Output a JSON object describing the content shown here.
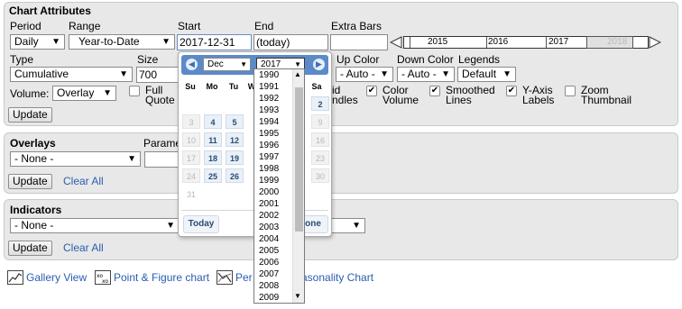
{
  "chart_attributes": {
    "title": "Chart Attributes",
    "period_label": "Period",
    "period_value": "Daily",
    "range_label": "Range",
    "range_value": "Year-to-Date",
    "start_label": "Start",
    "start_value": "2017-12-31",
    "end_label": "End",
    "end_value": "(today)",
    "extra_bars_label": "Extra Bars",
    "extra_bars_value": "",
    "timeline_years": [
      "2015",
      "2016",
      "2017",
      "2018"
    ],
    "type_label": "Type",
    "type_value": "Cumulative",
    "size_label": "Size",
    "size_value": "700",
    "up_color_label": "Up Color",
    "up_color_value": "- Auto -",
    "down_color_label": "Down Color",
    "down_color_value": "- Auto -",
    "legends_label": "Legends",
    "legends_value": "Default",
    "volume_label": "Volume:",
    "volume_value": "Overlay",
    "full_quote_label_1": "Full",
    "full_quote_label_2": "Quote",
    "solid_candles_label_1": "id",
    "solid_candles_label_2": "ndles",
    "color_volume_label_1": "Color",
    "color_volume_label_2": "Volume",
    "smoothed_lines_label_1": "Smoothed",
    "smoothed_lines_label_2": "Lines",
    "y_axis_labels_label_1": "Y-Axis",
    "y_axis_labels_label_2": "Labels",
    "zoom_thumbnail_label_1": "Zoom",
    "zoom_thumbnail_label_2": "Thumbnail",
    "update_label": "Update"
  },
  "overlays": {
    "title": "Overlays",
    "params_label": "Parame",
    "select_value": "- None -",
    "update_label": "Update",
    "clear_all_label": "Clear All"
  },
  "indicators": {
    "title": "Indicators",
    "select_value": "- None -",
    "update_label": "Update",
    "clear_all_label": "Clear All"
  },
  "footer_links": {
    "gallery_view": "Gallery View",
    "point_figure": "Point & Figure chart",
    "perf_prefix": "Per",
    "seasonality_suffix": "asonality Chart"
  },
  "datepicker": {
    "prev_icon": "◀",
    "next_icon": "▶",
    "month_value": "Dec",
    "year_value": "2017",
    "weekdays": [
      "Su",
      "Mo",
      "Tu",
      "W",
      "Sa"
    ],
    "row1": [
      "",
      "",
      "",
      "2"
    ],
    "row2": [
      "3",
      "4",
      "5",
      "9"
    ],
    "row3": [
      "10",
      "11",
      "12",
      "16"
    ],
    "row4": [
      "17",
      "18",
      "19",
      "23"
    ],
    "row5": [
      "24",
      "25",
      "26",
      "30"
    ],
    "row6": [
      "31"
    ],
    "today_label": "Today",
    "done_label": "one"
  },
  "year_options": [
    "1990",
    "1991",
    "1992",
    "1993",
    "1994",
    "1995",
    "1996",
    "1997",
    "1998",
    "1999",
    "2000",
    "2001",
    "2002",
    "2003",
    "2004",
    "2005",
    "2006",
    "2007",
    "2008",
    "2009"
  ]
}
